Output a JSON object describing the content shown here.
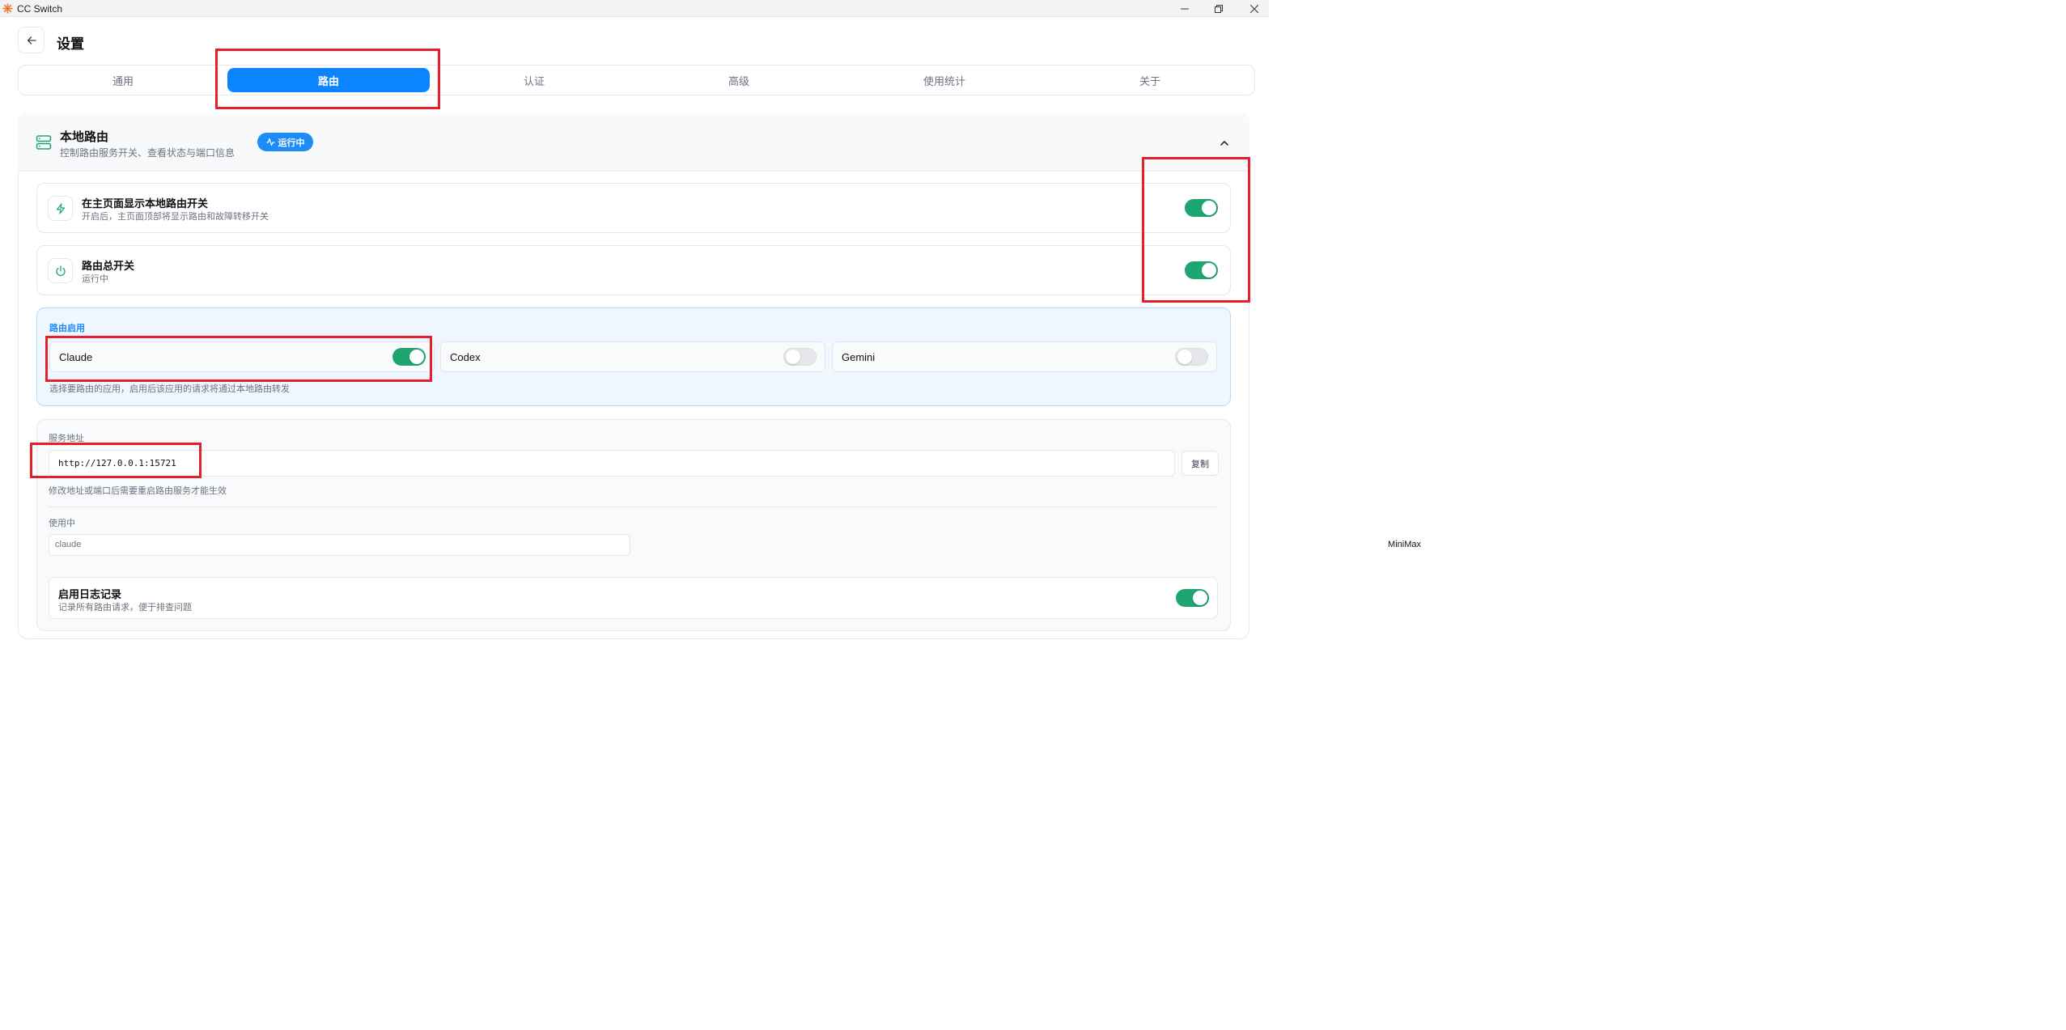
{
  "window": {
    "title": "CC Switch",
    "colors": {
      "accent": "#0a84ff",
      "toggle_on": "#1ea672",
      "highlight": "#e5202a"
    }
  },
  "header": {
    "page_title": "设置"
  },
  "tabs": [
    {
      "label": "通用"
    },
    {
      "label": "路由",
      "active": true
    },
    {
      "label": "认证"
    },
    {
      "label": "高级"
    },
    {
      "label": "使用统计"
    },
    {
      "label": "关于"
    }
  ],
  "section": {
    "title": "本地路由",
    "subtitle": "控制路由服务开关、查看状态与端口信息",
    "badge": "运行中"
  },
  "rows": {
    "show_toggle": {
      "title": "在主页面显示本地路由开关",
      "desc": "开启后，主页面顶部将显示路由和故障转移开关",
      "enabled": true
    },
    "master_switch": {
      "title": "路由总开关",
      "desc": "运行中",
      "enabled": true
    }
  },
  "routing": {
    "label": "路由启用",
    "apps": [
      {
        "name": "Claude",
        "enabled": true
      },
      {
        "name": "Codex",
        "enabled": false
      },
      {
        "name": "Gemini",
        "enabled": false
      }
    ],
    "help": "选择要路由的应用，启用后该应用的请求将通过本地路由转发"
  },
  "service": {
    "label": "服务地址",
    "address": "http://127.0.0.1:15721",
    "copy_label": "复制",
    "help": "修改地址或端口后需要重启路由服务才能生效"
  },
  "in_use": {
    "label": "使用中",
    "app": "claude",
    "provider": "MiniMax"
  },
  "logging": {
    "title": "启用日志记录",
    "desc": "记录所有路由请求，便于排查问题",
    "enabled": true
  }
}
